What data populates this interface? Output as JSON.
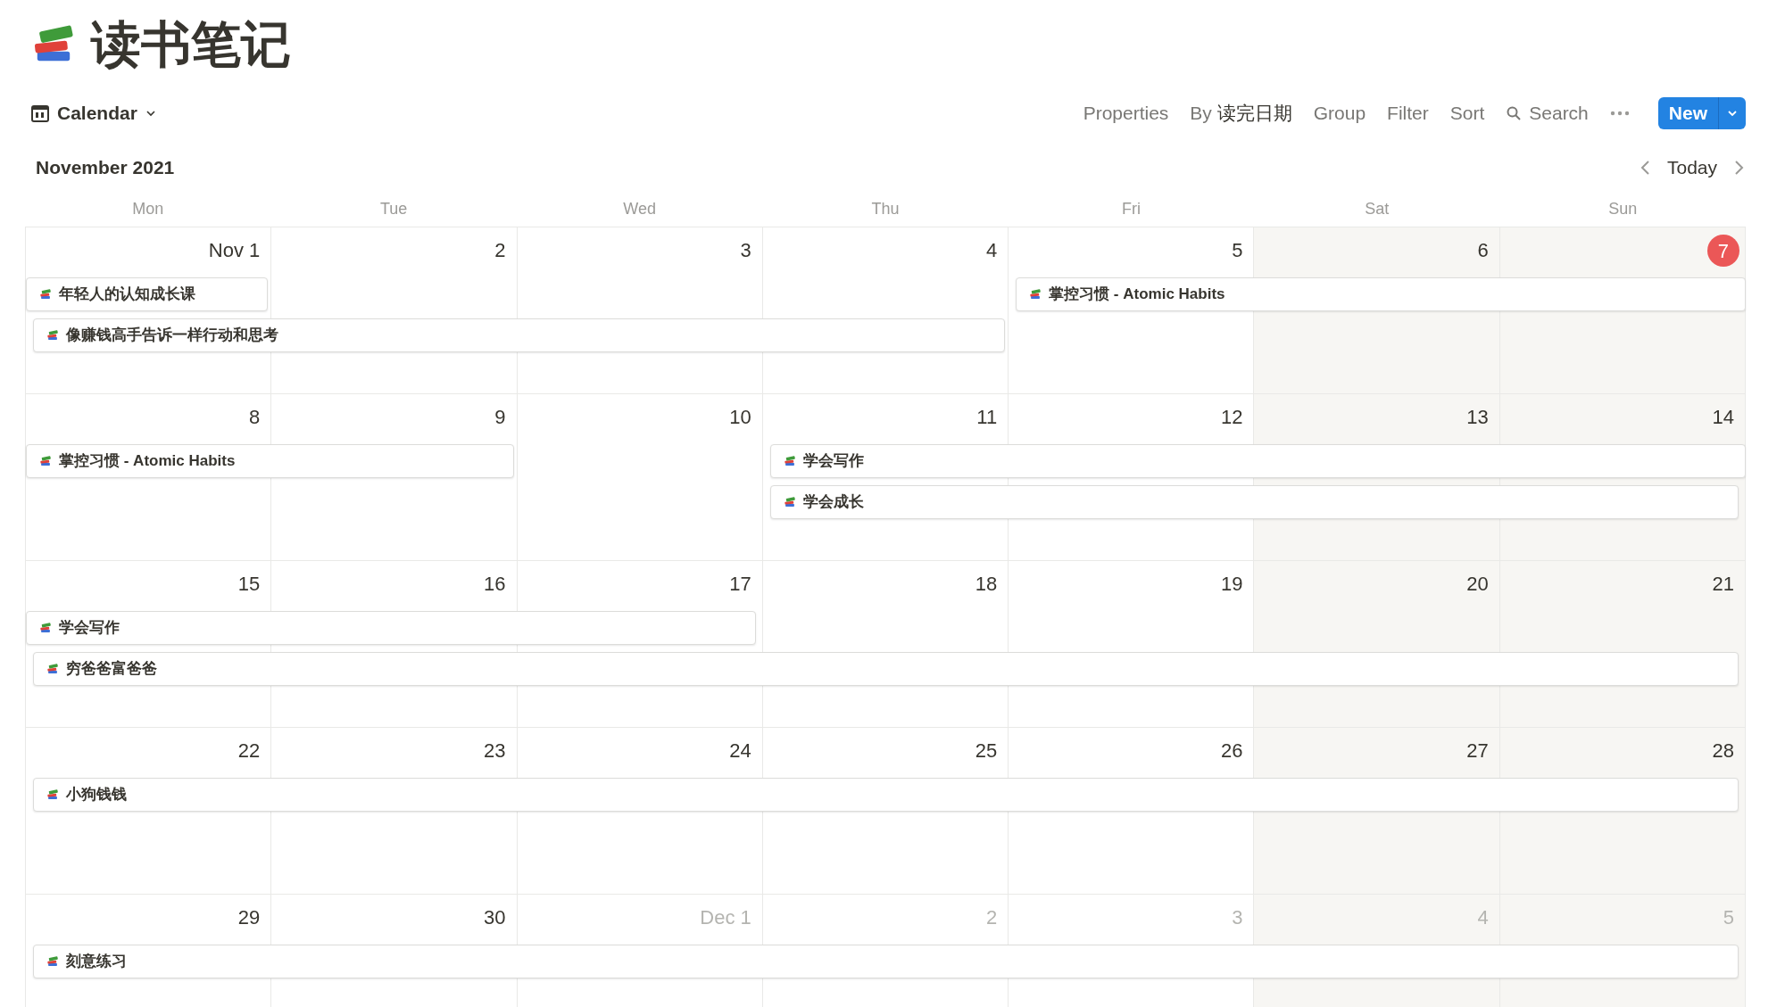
{
  "page": {
    "title": "读书笔记"
  },
  "toolbar": {
    "view": "Calendar",
    "items": [
      {
        "kind": "plain",
        "label": "Properties"
      },
      {
        "kind": "by",
        "prefix": "By",
        "label": "读完日期"
      },
      {
        "kind": "plain",
        "label": "Group"
      },
      {
        "kind": "plain",
        "label": "Filter"
      },
      {
        "kind": "plain",
        "label": "Sort"
      },
      {
        "kind": "search",
        "label": "Search"
      }
    ],
    "new_button": "New"
  },
  "calendar": {
    "month": "November 2021",
    "today_button": "Today",
    "weekdays": [
      "Mon",
      "Tue",
      "Wed",
      "Thu",
      "Fri",
      "Sat",
      "Sun"
    ],
    "weeks": [
      {
        "days": [
          {
            "label": "Nov 1",
            "muted": false,
            "today": false
          },
          {
            "label": "2",
            "muted": false,
            "today": false
          },
          {
            "label": "3",
            "muted": false,
            "today": false
          },
          {
            "label": "4",
            "muted": false,
            "today": false
          },
          {
            "label": "5",
            "muted": false,
            "today": false
          },
          {
            "label": "6",
            "muted": false,
            "today": false
          },
          {
            "label": "7",
            "muted": false,
            "today": true
          }
        ],
        "events": [
          "年轻人的认知成长课",
          "像赚钱高手告诉一样行动和思考",
          "掌控习惯 - Atomic Habits"
        ]
      },
      {
        "days": [
          {
            "label": "8",
            "muted": false,
            "today": false
          },
          {
            "label": "9",
            "muted": false,
            "today": false
          },
          {
            "label": "10",
            "muted": false,
            "today": false
          },
          {
            "label": "11",
            "muted": false,
            "today": false
          },
          {
            "label": "12",
            "muted": false,
            "today": false
          },
          {
            "label": "13",
            "muted": false,
            "today": false
          },
          {
            "label": "14",
            "muted": false,
            "today": false
          }
        ],
        "events": [
          "掌控习惯 - Atomic Habits",
          "学会写作",
          "学会成长"
        ]
      },
      {
        "days": [
          {
            "label": "15",
            "muted": false,
            "today": false
          },
          {
            "label": "16",
            "muted": false,
            "today": false
          },
          {
            "label": "17",
            "muted": false,
            "today": false
          },
          {
            "label": "18",
            "muted": false,
            "today": false
          },
          {
            "label": "19",
            "muted": false,
            "today": false
          },
          {
            "label": "20",
            "muted": false,
            "today": false
          },
          {
            "label": "21",
            "muted": false,
            "today": false
          }
        ],
        "events": [
          "学会写作",
          "穷爸爸富爸爸"
        ]
      },
      {
        "days": [
          {
            "label": "22",
            "muted": false,
            "today": false
          },
          {
            "label": "23",
            "muted": false,
            "today": false
          },
          {
            "label": "24",
            "muted": false,
            "today": false
          },
          {
            "label": "25",
            "muted": false,
            "today": false
          },
          {
            "label": "26",
            "muted": false,
            "today": false
          },
          {
            "label": "27",
            "muted": false,
            "today": false
          },
          {
            "label": "28",
            "muted": false,
            "today": false
          }
        ],
        "events": [
          "小狗钱钱"
        ]
      },
      {
        "days": [
          {
            "label": "29",
            "muted": false,
            "today": false
          },
          {
            "label": "30",
            "muted": false,
            "today": false
          },
          {
            "label": "Dec 1",
            "muted": true,
            "today": false
          },
          {
            "label": "2",
            "muted": true,
            "today": false
          },
          {
            "label": "3",
            "muted": true,
            "today": false
          },
          {
            "label": "4",
            "muted": true,
            "today": false
          },
          {
            "label": "5",
            "muted": true,
            "today": false
          }
        ],
        "events": [
          "刻意练习"
        ]
      }
    ]
  }
}
